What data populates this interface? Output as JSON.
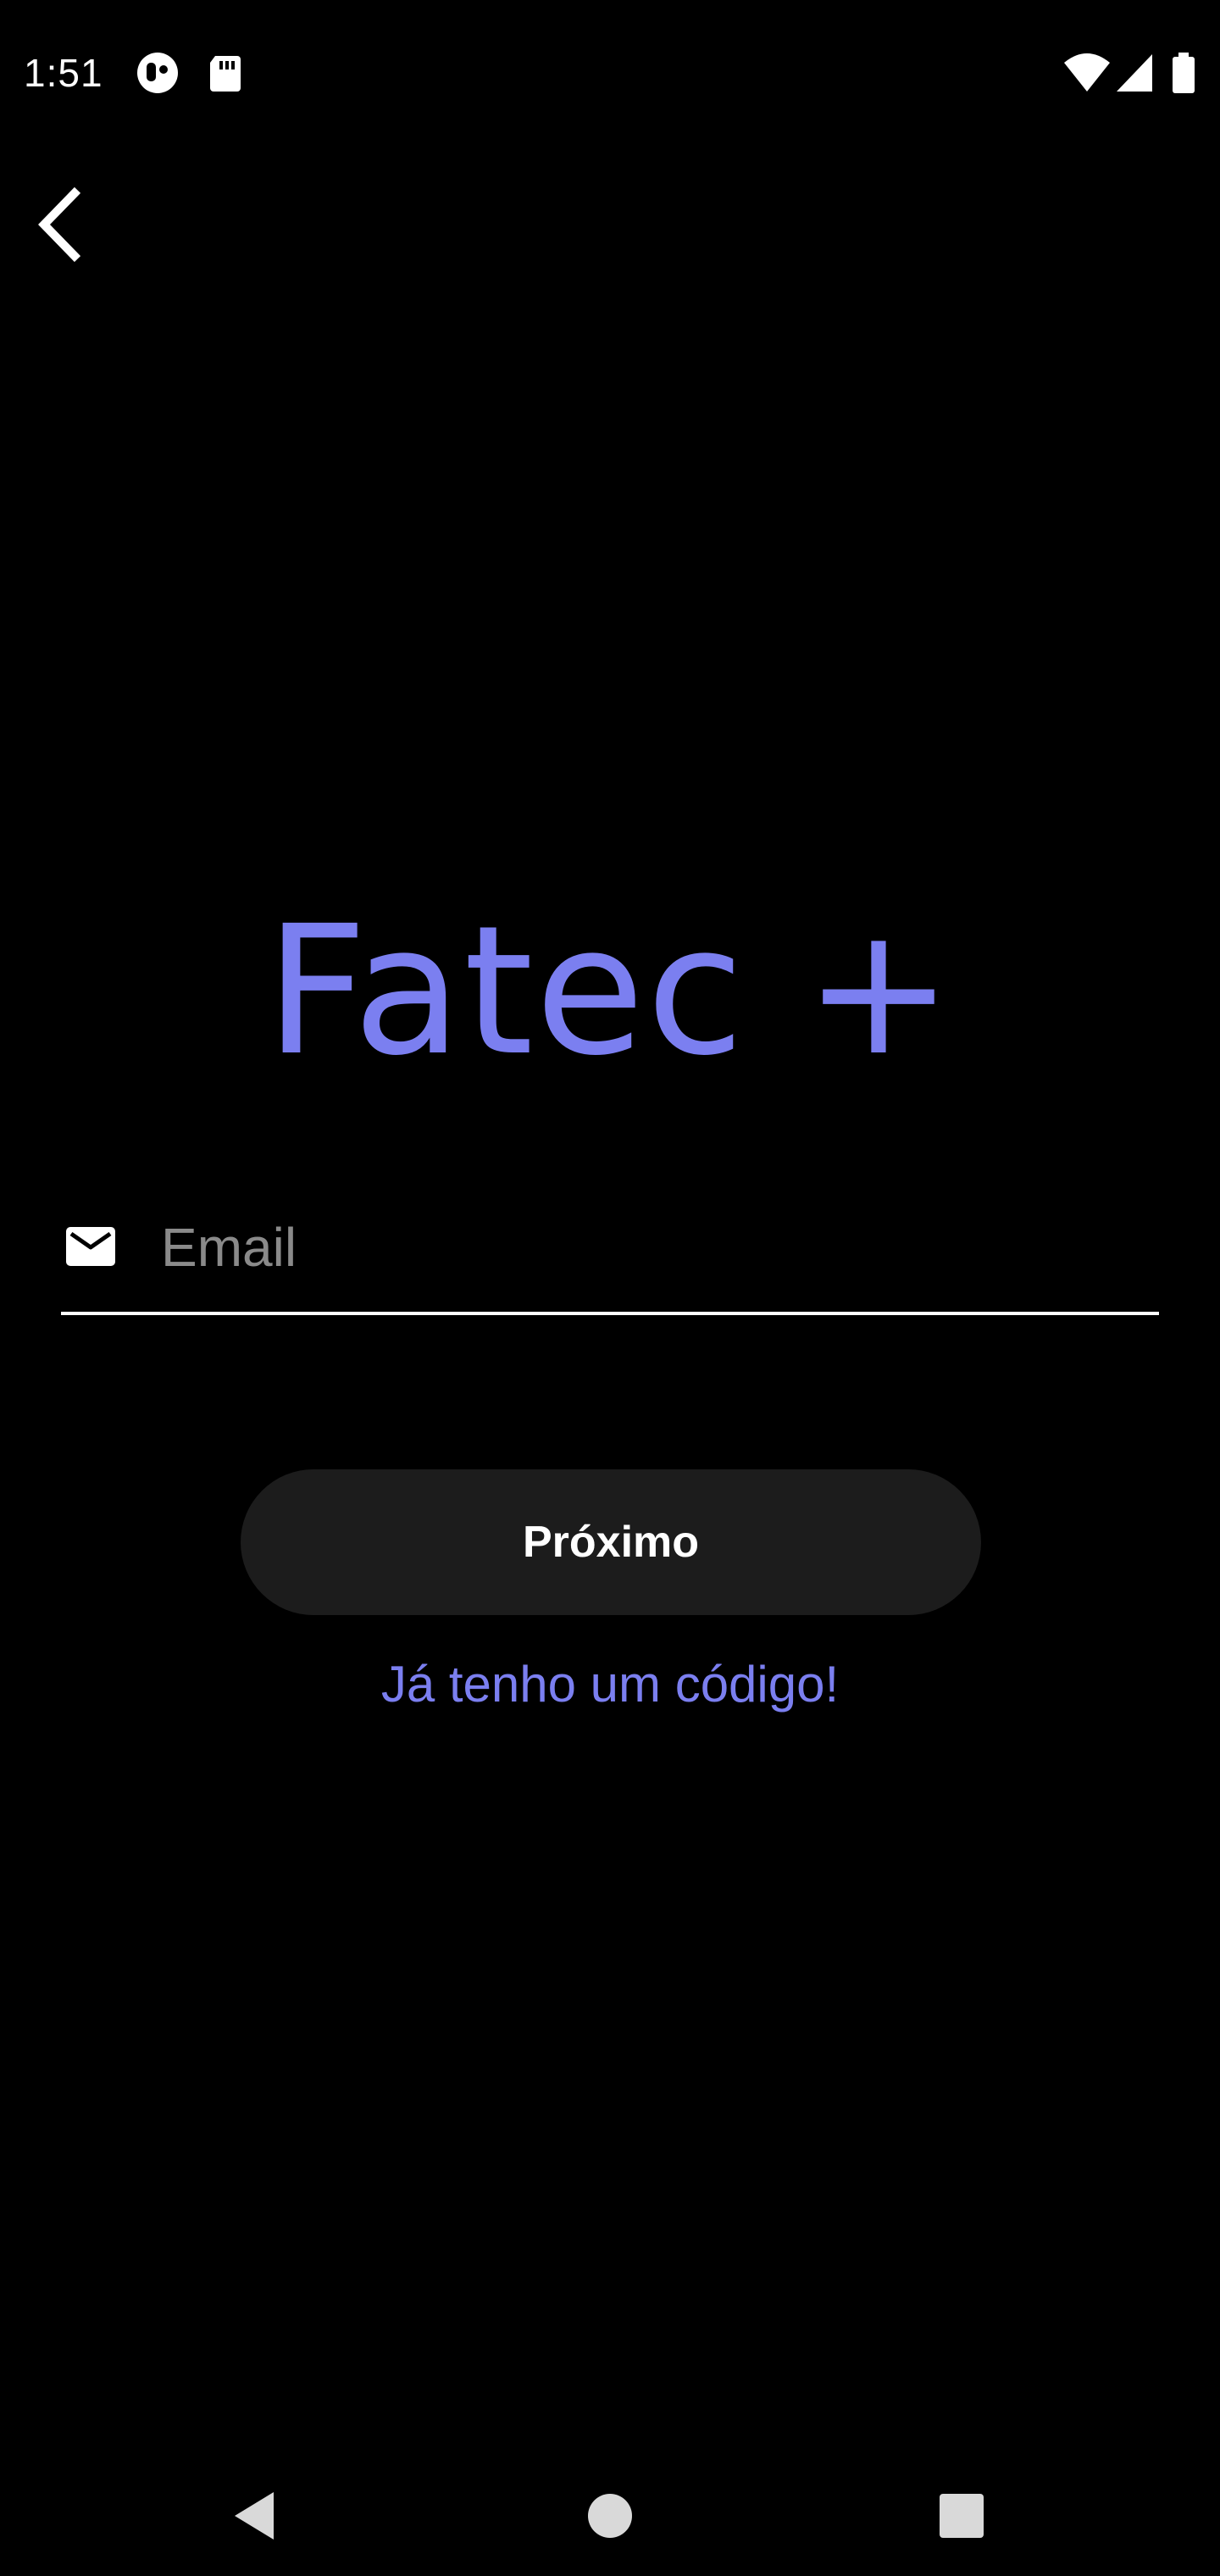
{
  "status_bar": {
    "time": "1:51",
    "left_icons": [
      "app-notification-icon",
      "sd-card-icon"
    ],
    "right_icons": [
      "wifi-icon",
      "cell-signal-icon",
      "battery-icon"
    ]
  },
  "header": {
    "back_icon": "chevron-left-icon"
  },
  "app": {
    "title": "Fatec +",
    "accent_color": "#7b7ff0"
  },
  "form": {
    "email": {
      "icon": "mail-icon",
      "value": "",
      "placeholder": "Email"
    },
    "next_label": "Próximo",
    "code_link_label": "Já tenho um código!"
  },
  "nav_bar": {
    "buttons": [
      "back-triangle-icon",
      "home-circle-icon",
      "recents-square-icon"
    ]
  }
}
